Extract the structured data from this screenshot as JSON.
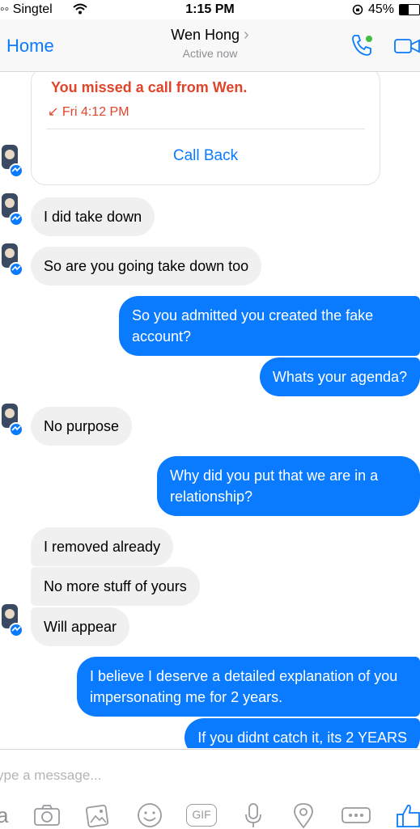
{
  "status_bar": {
    "carrier": "◦◦ Singtel",
    "time": "1:15 PM",
    "battery": "45%",
    "battery_level": 0.45
  },
  "header": {
    "back_label": "Home",
    "contact_name": "Wen Hong",
    "chevron": "›",
    "status": "Active now",
    "accent_color": "#0a7bff",
    "online_color": "#44bb44"
  },
  "call_card": {
    "missed_text": "You missed a call from Wen.",
    "time_text": "↙ Fri 4:12 PM",
    "call_back_label": "Call Back"
  },
  "messages": [
    {
      "from": "them",
      "text": "I did take down"
    },
    {
      "from": "them",
      "text": "So are you going take down too"
    },
    {
      "from": "me",
      "text": "So you admitted you created the fake account?"
    },
    {
      "from": "me",
      "text": "Whats your agenda?"
    },
    {
      "from": "them",
      "text": "No purpose"
    },
    {
      "from": "me",
      "text": "Why did you put that we are in a relationship?"
    },
    {
      "from": "them",
      "text": "I removed already"
    },
    {
      "from": "them",
      "text": "No more stuff of yours"
    },
    {
      "from": "them",
      "text": "Will appear"
    },
    {
      "from": "me",
      "text": "I believe I deserve a detailed explanation of you impersonating me for 2 years."
    },
    {
      "from": "me",
      "text": "If you didnt catch it, its 2 YEARS"
    }
  ],
  "composer": {
    "placeholder": "ype a message...",
    "icons": [
      "keyboard-icon",
      "camera-icon",
      "gallery-icon",
      "emoji-icon",
      "gif-icon",
      "microphone-icon",
      "location-icon",
      "more-icon",
      "like-icon"
    ],
    "gif_label": "GIF"
  }
}
